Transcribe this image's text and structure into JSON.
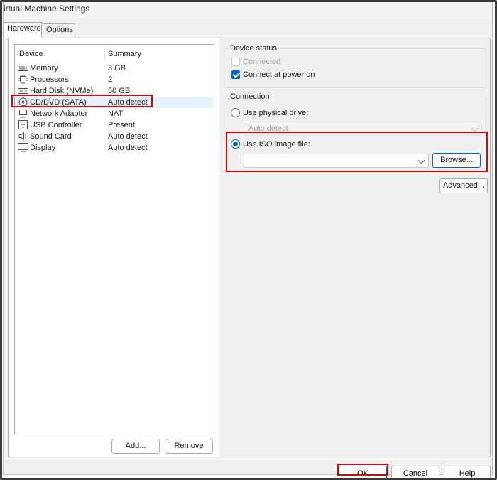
{
  "window": {
    "title": "irtual Machine Settings"
  },
  "tabs": [
    {
      "label": "Hardware"
    },
    {
      "label": "Options"
    }
  ],
  "device_list": {
    "headers": {
      "device": "Device",
      "summary": "Summary"
    },
    "rows": [
      {
        "device": "Memory",
        "summary": "3 GB",
        "icon": "memory-icon"
      },
      {
        "device": "Processors",
        "summary": "2",
        "icon": "processor-icon"
      },
      {
        "device": "Hard Disk (NVMe)",
        "summary": "50 GB",
        "icon": "hard-disk-icon"
      },
      {
        "device": "CD/DVD (SATA)",
        "summary": "Auto detect",
        "icon": "cd-dvd-icon"
      },
      {
        "device": "Network Adapter",
        "summary": "NAT",
        "icon": "network-adapter-icon"
      },
      {
        "device": "USB Controller",
        "summary": "Present",
        "icon": "usb-controller-icon"
      },
      {
        "device": "Sound Card",
        "summary": "Auto detect",
        "icon": "sound-card-icon"
      },
      {
        "device": "Display",
        "summary": "Auto detect",
        "icon": "display-icon"
      }
    ],
    "add_label": "Add...",
    "remove_label": "Remove"
  },
  "device_status": {
    "title": "Device status",
    "connected_label": "Connected",
    "connected_checked": false,
    "connect_power_label": "Connect at power on",
    "connect_power_checked": true
  },
  "connection": {
    "title": "Connection",
    "physical_label": "Use physical drive:",
    "physical_value": "Auto detect",
    "iso_label": "Use ISO image file:",
    "iso_value": "",
    "browse_label": "Browse...",
    "advanced_label": "Advanced..."
  },
  "footer": {
    "ok_label": "OK",
    "cancel_label": "Cancel",
    "help_label": "Help"
  },
  "colors": {
    "accent": "#0067c0",
    "highlight": "#e00000"
  }
}
